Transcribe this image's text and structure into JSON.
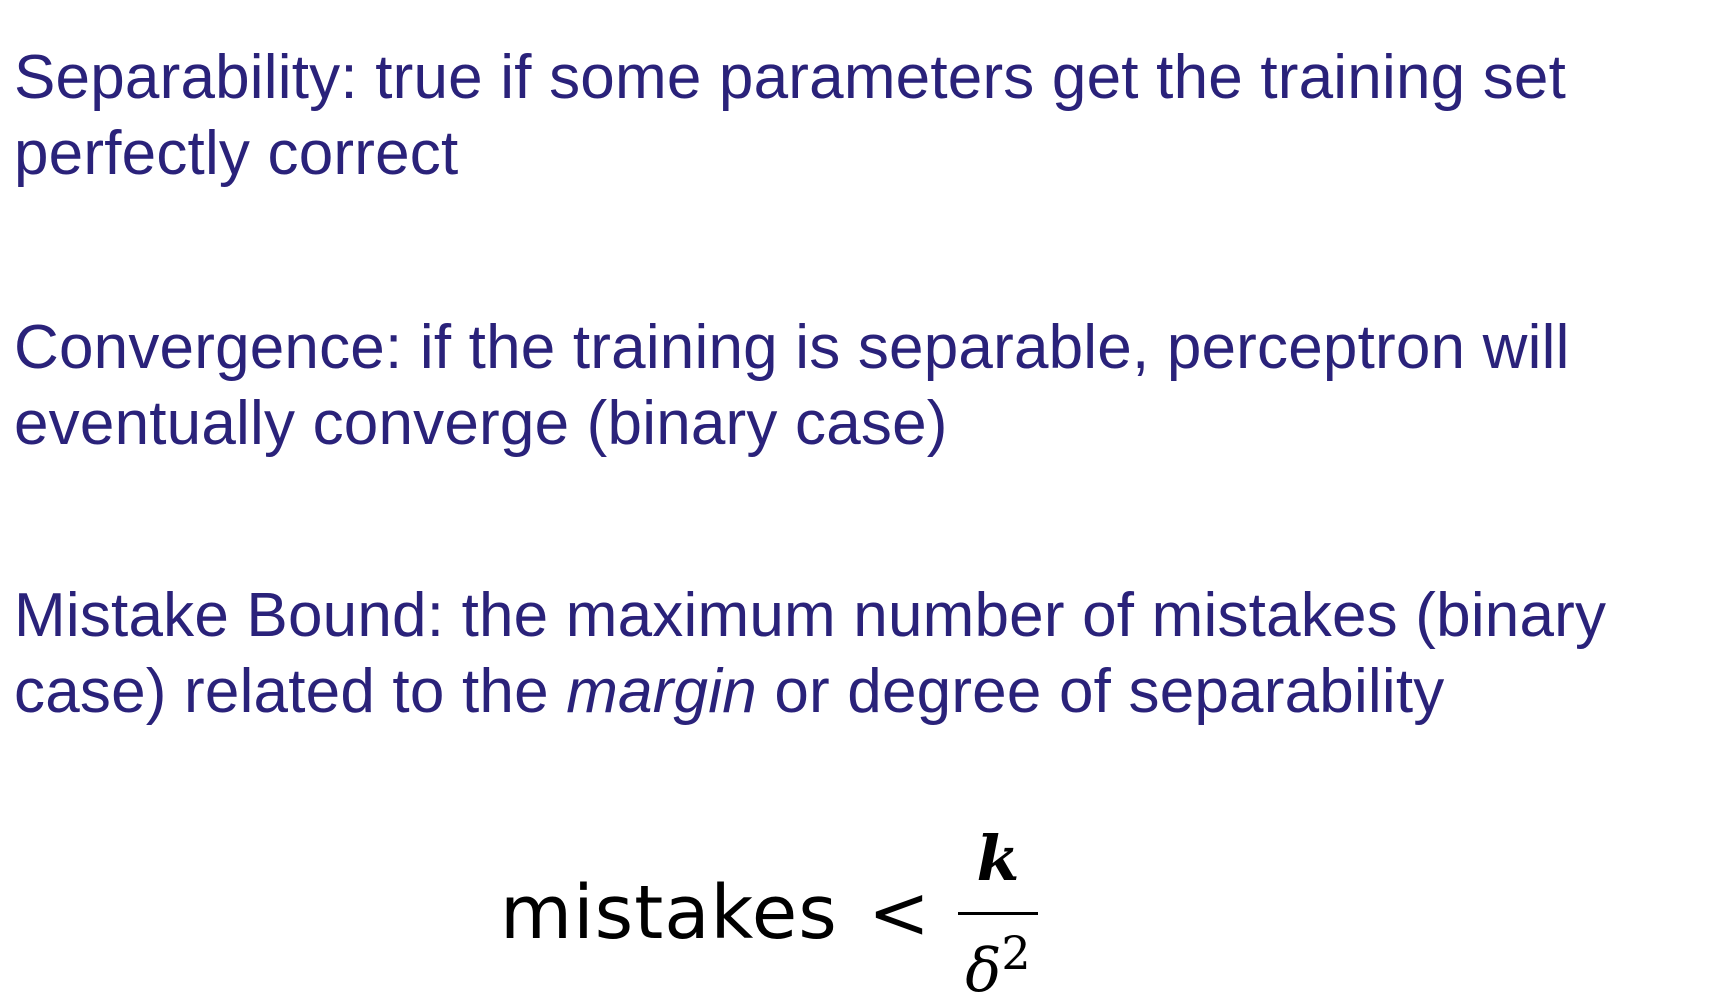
{
  "paragraphs": [
    {
      "line1": "Separability: true if some parameters get the training set",
      "line2": "perfectly correct"
    },
    {
      "line1": "Convergence: if the training is separable, perceptron will",
      "line2": "eventually converge (binary case)"
    },
    {
      "line1": "Mistake Bound: the maximum number of mistakes (binary",
      "line2_pre": "case) related to the ",
      "line2_em": "margin",
      "line2_post": " or degree of separability"
    }
  ],
  "formula": {
    "lhs": "mistakes",
    "relation": "<",
    "numerator": "k",
    "denominator_base": "δ",
    "denominator_exponent": "2"
  },
  "colors": {
    "text": "#2a227a",
    "formula": "#000000",
    "background": "#ffffff"
  }
}
